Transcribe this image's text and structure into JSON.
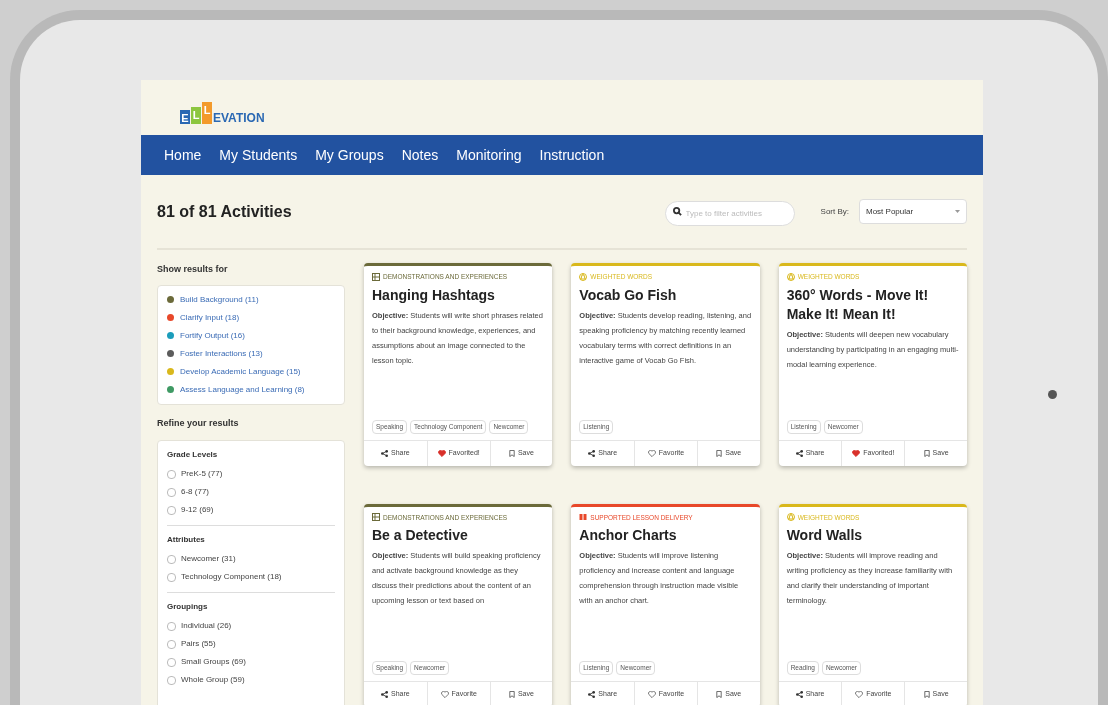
{
  "logo": {
    "letters": [
      {
        "text": "E",
        "color": "#2a68b3"
      },
      {
        "text": "L",
        "color": "#8cc63f"
      },
      {
        "text": "L",
        "color": "#f39a2b"
      }
    ],
    "rest": "EVATION"
  },
  "nav": [
    {
      "label": "Home"
    },
    {
      "label": "My Students"
    },
    {
      "label": "My Groups"
    },
    {
      "label": "Notes"
    },
    {
      "label": "Monitoring"
    },
    {
      "label": "Instruction"
    }
  ],
  "heading": "81 of 81 Activities",
  "search": {
    "placeholder": "Type to filter activities"
  },
  "sort": {
    "label": "Sort By:",
    "value": "Most Popular"
  },
  "show_results": {
    "title": "Show results for",
    "items": [
      {
        "label": "Build Background (11)",
        "color": "#6b6a3a"
      },
      {
        "label": "Clarify Input (18)",
        "color": "#e8482a"
      },
      {
        "label": "Fortify Output (16)",
        "color": "#1b9dbb"
      },
      {
        "label": "Foster Interactions (13)",
        "color": "#5c5c5c"
      },
      {
        "label": "Develop Academic Language (15)",
        "color": "#d9b81c"
      },
      {
        "label": "Assess Language and Learning (8)",
        "color": "#3f9a64"
      }
    ]
  },
  "refine": {
    "title": "Refine your results",
    "groups": [
      {
        "title": "Grade Levels",
        "options": [
          {
            "label": "PreK-5 (77)",
            "checked": false
          },
          {
            "label": "6-8 (77)",
            "checked": false
          },
          {
            "label": "9-12 (69)",
            "checked": false
          }
        ]
      },
      {
        "title": "Attributes",
        "options": [
          {
            "label": "Newcomer (31)",
            "checked": false
          },
          {
            "label": "Technology Component (18)",
            "checked": false
          }
        ]
      },
      {
        "title": "Groupings",
        "options": [
          {
            "label": "Individual (26)",
            "checked": false
          },
          {
            "label": "Pairs (55)",
            "checked": false
          },
          {
            "label": "Small Groups (69)",
            "checked": false
          },
          {
            "label": "Whole Group (59)",
            "checked": false
          }
        ]
      }
    ]
  },
  "cards": [
    {
      "category": "DEMONSTRATIONS AND EXPERIENCES",
      "kind": "demonstrations",
      "color": "#6b6a3a",
      "title": "Hanging Hashtags",
      "objective": "**Objective:** Students will write short phrases related to their background knowledge, experiences, and assumptions about an image connected to the lesson topic.",
      "tags": [
        "Speaking",
        "Technology Component",
        "Newcomer"
      ],
      "share": "Share",
      "favorite": {
        "label": "Favorited!",
        "favorited": true
      },
      "save": "Save"
    },
    {
      "category": "WEIGHTED WORDS",
      "kind": "weighted",
      "color": "#d9b81c",
      "title": "Vocab Go Fish",
      "objective": "**Objective:** Students develop reading, listening, and speaking proficiency by matching recently learned vocabulary terms with correct definitions in an interactive game of Vocab Go Fish.",
      "tags": [
        "Listening"
      ],
      "share": "Share",
      "favorite": {
        "label": "Favorite",
        "favorited": false
      },
      "save": "Save"
    },
    {
      "category": "WEIGHTED WORDS",
      "kind": "weighted",
      "color": "#d9b81c",
      "title": "360° Words - Move It! Make It! Mean It!",
      "objective": "**Objective:** Students will deepen new vocabulary understanding by participating in an engaging multi-modal learning experience.",
      "tags": [
        "Listening",
        "Newcomer"
      ],
      "share": "Share",
      "favorite": {
        "label": "Favorited!",
        "favorited": true
      },
      "save": "Save"
    },
    {
      "category": "DEMONSTRATIONS AND EXPERIENCES",
      "kind": "demonstrations",
      "color": "#6b6a3a",
      "title": "Be a Detective",
      "objective": "**Objective:** Students will build speaking proficiency and activate background knowledge as they discuss their predictions about the content of an upcoming lesson or text based on",
      "tags": [
        "Speaking",
        "Newcomer"
      ],
      "share": "Share",
      "favorite": {
        "label": "Favorite",
        "favorited": false
      },
      "save": "Save"
    },
    {
      "category": "SUPPORTED LESSON DELIVERY",
      "kind": "supported",
      "color": "#e8482a",
      "title": "Anchor Charts",
      "objective": "**Objective:** Students will improve listening proficiency and increase content and language comprehension through instruction made visible with an anchor chart.",
      "tags": [
        "Listening",
        "Newcomer"
      ],
      "share": "Share",
      "favorite": {
        "label": "Favorite",
        "favorited": false
      },
      "save": "Save"
    },
    {
      "category": "WEIGHTED WORDS",
      "kind": "weighted",
      "color": "#d9b81c",
      "title": "Word Walls",
      "objective": "**Objective:** Students will improve reading and writing proficiency as they increase familiarity with and clarify their understanding of important terminology.",
      "tags": [
        "Reading",
        "Newcomer"
      ],
      "share": "Share",
      "favorite": {
        "label": "Favorite",
        "favorited": false
      },
      "save": "Save"
    }
  ]
}
